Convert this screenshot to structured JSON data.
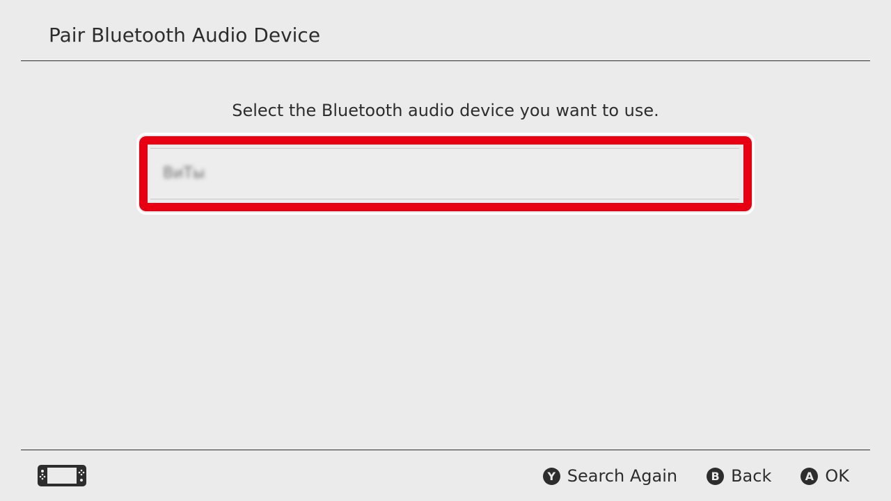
{
  "header": {
    "title": "Pair Bluetooth Audio Device"
  },
  "main": {
    "instruction": "Select the Bluetooth audio device you want to use.",
    "devices": [
      {
        "name": "ВиТы",
        "selected": true
      }
    ],
    "highlight_color": "#e60012"
  },
  "footer": {
    "mode_icon": "handheld-console-icon",
    "actions": [
      {
        "button": "Y",
        "label": "Search Again"
      },
      {
        "button": "B",
        "label": "Back"
      },
      {
        "button": "A",
        "label": "OK"
      }
    ]
  }
}
